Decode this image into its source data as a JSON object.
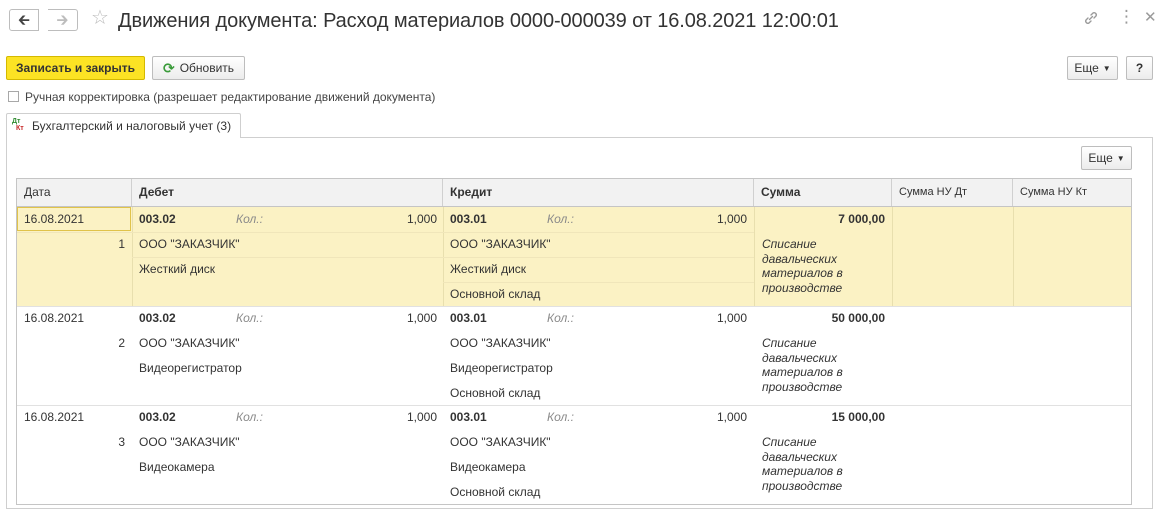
{
  "window": {
    "title": "Движения документа: Расход материалов 0000-000039 от 16.08.2021 12:00:01",
    "icons": [
      "back-arrow-icon",
      "forward-arrow-icon",
      "star-icon",
      "link-icon",
      "more-icon",
      "close-icon"
    ]
  },
  "toolbar": {
    "save_close_label": "Записать и закрыть",
    "refresh_label": "Обновить",
    "more_label": "Еще",
    "help_label": "?"
  },
  "manual": {
    "label": "Ручная корректировка (разрешает редактирование движений документа)",
    "checked": false
  },
  "tab": {
    "label": "Бухгалтерский и налоговый учет (3)",
    "icon_top": "Дт",
    "icon_bottom": "Кт"
  },
  "table": {
    "more_label": "Еще",
    "headers": {
      "date": "Дата",
      "debit": "Дебет",
      "credit": "Кредит",
      "sum": "Сумма",
      "sum_nu_dt": "Сумма НУ Дт",
      "sum_nu_kt": "Сумма НУ Кт"
    },
    "rows": [
      {
        "date": "16.08.2021",
        "num": "1",
        "debit_account": "003.02",
        "debit_qty_label": "Кол.:",
        "debit_qty": "1,000",
        "debit_sub1": "ООО \"ЗАКАЗЧИК\"",
        "debit_sub2": "Жесткий диск",
        "credit_account": "003.01",
        "credit_qty_label": "Кол.:",
        "credit_qty": "1,000",
        "credit_sub1": "ООО \"ЗАКАЗЧИК\"",
        "credit_sub2": "Жесткий диск",
        "credit_sub3": "Основной склад",
        "sum": "7 000,00",
        "content": "Списание давальческих материалов в производстве"
      },
      {
        "date": "16.08.2021",
        "num": "2",
        "debit_account": "003.02",
        "debit_qty_label": "Кол.:",
        "debit_qty": "1,000",
        "debit_sub1": "ООО \"ЗАКАЗЧИК\"",
        "debit_sub2": "Видеорегистратор",
        "credit_account": "003.01",
        "credit_qty_label": "Кол.:",
        "credit_qty": "1,000",
        "credit_sub1": "ООО \"ЗАКАЗЧИК\"",
        "credit_sub2": "Видеорегистратор",
        "credit_sub3": "Основной склад",
        "sum": "50 000,00",
        "content": "Списание давальческих материалов в производстве"
      },
      {
        "date": "16.08.2021",
        "num": "3",
        "debit_account": "003.02",
        "debit_qty_label": "Кол.:",
        "debit_qty": "1,000",
        "debit_sub1": "ООО \"ЗАКАЗЧИК\"",
        "debit_sub2": "Видеокамера",
        "credit_account": "003.01",
        "credit_qty_label": "Кол.:",
        "credit_qty": "1,000",
        "credit_sub1": "ООО \"ЗАКАЗЧИК\"",
        "credit_sub2": "Видеокамера",
        "credit_sub3": "Основной склад",
        "sum": "15 000,00",
        "content": "Списание давальческих материалов в производстве"
      }
    ]
  },
  "colors": {
    "primary_button": "#fce324",
    "selected_row": "#fbf2c4"
  }
}
